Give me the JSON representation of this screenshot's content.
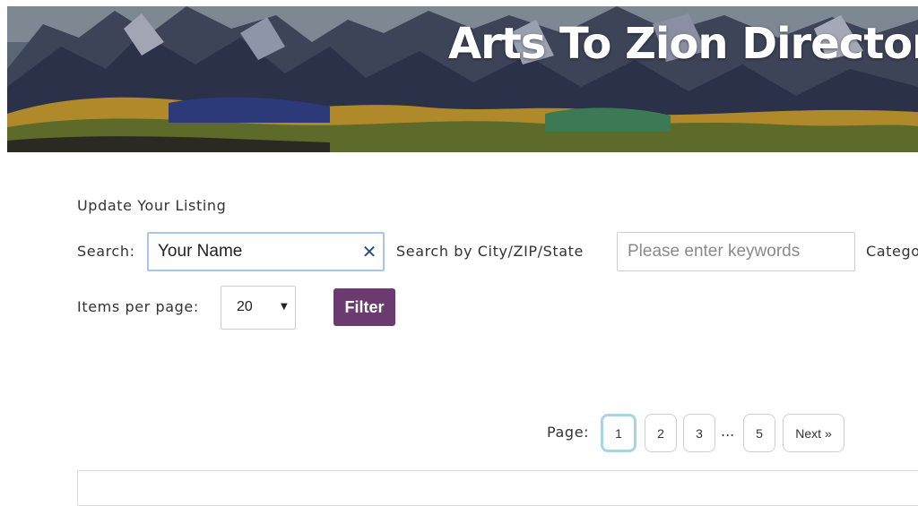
{
  "banner": {
    "title": "Arts To Zion Directory"
  },
  "update_link": "Update Your Listing",
  "search": {
    "label": "Search:",
    "value": "Your Name",
    "clear_icon": "close-icon"
  },
  "city_search": {
    "label": "Search by City/ZIP/State",
    "placeholder": "Please enter keywords"
  },
  "category": {
    "label": "Category"
  },
  "items_per_page": {
    "label": "Items per page:",
    "selected": "20",
    "arrow": "▼"
  },
  "filter_button": "Filter",
  "pagination": {
    "label": "Page:",
    "pages": [
      "1",
      "2",
      "3",
      "5"
    ],
    "ellipsis": "...",
    "next": "Next »",
    "current": "1"
  },
  "colors": {
    "filter_button": "#6b3a6e",
    "active_page_border": "#a9d4e4",
    "search_focus_border": "#a9c6e8",
    "clear_icon": "#2b4d80"
  }
}
